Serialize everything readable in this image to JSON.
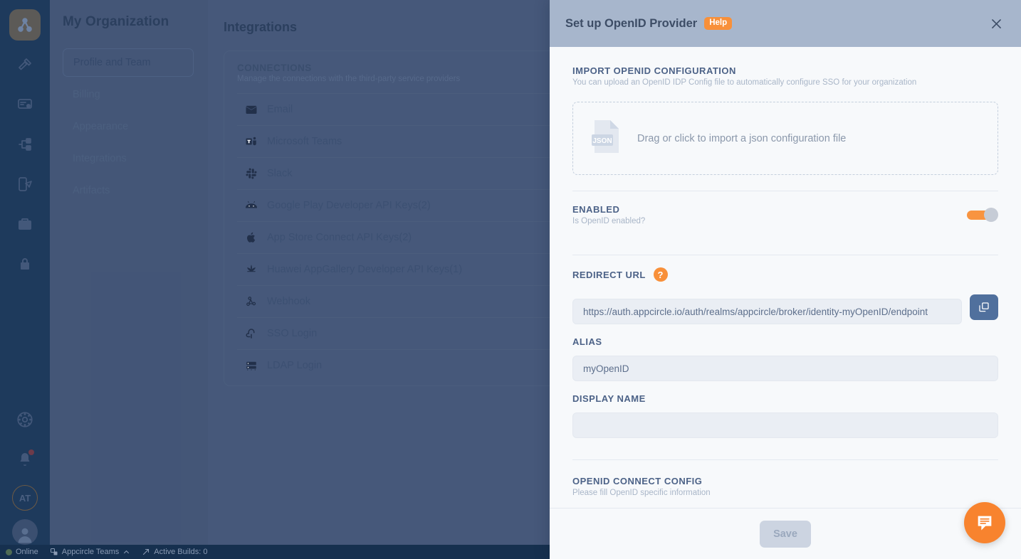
{
  "background": {
    "rail": {
      "logo_icon": "appcircle-logo-icon",
      "items": [
        {
          "icon": "hammer-build-icon"
        },
        {
          "icon": "certificate-signing-icon"
        },
        {
          "icon": "distribution-flow-icon"
        },
        {
          "icon": "testing-device-icon"
        },
        {
          "icon": "briefcase-enterprise-icon"
        },
        {
          "icon": "lock-user-icon"
        }
      ],
      "bottom": [
        {
          "icon": "settings-gear-icon"
        },
        {
          "icon": "notification-bell-icon",
          "has_badge": true
        }
      ],
      "org_initials": "AT",
      "account_icon": "user-avatar-icon"
    },
    "org_panel": {
      "title": "My Organization",
      "items": [
        {
          "label": "Profile and Team",
          "active": true
        },
        {
          "label": "Billing",
          "active": false
        },
        {
          "label": "Appearance",
          "active": false
        },
        {
          "label": "Integrations",
          "active": false
        },
        {
          "label": "Artifacts",
          "active": false
        }
      ]
    },
    "main": {
      "title": "Integrations",
      "card": {
        "heading": "CONNECTIONS",
        "subheading": "Manage the connections with the third-party service providers",
        "rows": [
          {
            "icon": "email-icon",
            "label": "Email"
          },
          {
            "icon": "microsoft-teams-icon",
            "label": "Microsoft Teams"
          },
          {
            "icon": "slack-icon",
            "label": "Slack"
          },
          {
            "icon": "android-icon",
            "label": "Google Play Developer API Keys(2)"
          },
          {
            "icon": "apple-icon",
            "label": "App Store Connect API Keys(2)"
          },
          {
            "icon": "huawei-icon",
            "label": "Huawei AppGallery Developer API Keys(1)"
          },
          {
            "icon": "webhook-icon",
            "label": "Webhook"
          },
          {
            "icon": "sso-login-icon",
            "label": "SSO Login"
          },
          {
            "icon": "ldap-server-icon",
            "label": "LDAP Login"
          }
        ]
      }
    },
    "statusbar": {
      "online_label": "Online",
      "org_label": "Appcircle Teams",
      "builds_label": "Active Builds: 0"
    }
  },
  "modal": {
    "title": "Set up OpenID Provider",
    "help_badge": "Help",
    "close_icon": "close-icon",
    "import": {
      "heading": "IMPORT OPENID CONFIGURATION",
      "subheading": "You can upload an OpenID IDP Config file to automatically configure SSO for your organization",
      "dropzone_label": "Drag or click to import a json configuration file",
      "file_icon_label": "JSON"
    },
    "enabled": {
      "heading": "ENABLED",
      "subheading": "Is OpenID enabled?",
      "toggle_on": true
    },
    "redirect_url": {
      "label": "REDIRECT URL",
      "help_glyph": "?",
      "value": "https://auth.appcircle.io/auth/realms/appcircle/broker/identity-myOpenID/endpoint",
      "copy_icon": "copy-icon"
    },
    "alias": {
      "label": "ALIAS",
      "value": "myOpenID"
    },
    "display_name": {
      "label": "DISPLAY NAME",
      "value": "",
      "placeholder": ""
    },
    "connect_config": {
      "heading": "OPENID CONNECT CONFIG",
      "subheading": "Please fill OpenID specific information"
    },
    "save_label": "Save"
  },
  "fab": {
    "icon": "chat-support-icon"
  },
  "colors": {
    "accent_orange": "#f8903a",
    "modal_header": "#a7b6cc",
    "rail_bg": "#1e3a5c",
    "copy_button": "#50709d"
  }
}
